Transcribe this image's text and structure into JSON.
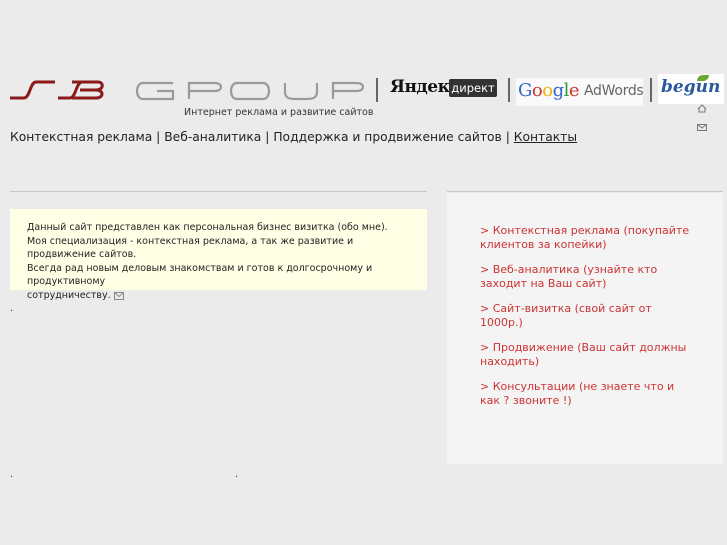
{
  "brand": {
    "logo_s3_name": "S3",
    "logo_group_name": "GROUP",
    "tagline": "Интернет реклама и развитие сайтов"
  },
  "partners": {
    "yandex_name": "Яндекс",
    "yandex_product": "директ",
    "google_name": "Google",
    "google_product": "AdWords",
    "begun_name": "begun"
  },
  "nav": {
    "items": [
      "Контекстная реклама",
      "Веб-аналитика",
      "Поддержка и продвижение сайтов",
      "Контакты"
    ],
    "separator": " | "
  },
  "intro": {
    "lines": [
      "Данный сайт представлен как персональная бизнес визитка (обо мне).",
      "Моя специализация - контекстная реклама, а так же развитие и продвижение сайтов.",
      "Всегда рад новым деловым знакомствам и готов к долгосрочному и продуктивному",
      "сотрудничеству."
    ]
  },
  "dots": [
    ".",
    ".",
    "."
  ],
  "sidebar": {
    "items": [
      "> Контекстная реклама (покупайте клиентов за копейки)",
      "> Веб-аналитика (узнайте кто заходит на Ваш сайт)",
      "> Сайт-визитка (свой сайт от 1000р.)",
      "> Продвижение (Ваш сайт должны находить)",
      "> Консультации (не знаете что и как ? звоните !)"
    ]
  },
  "colors": {
    "logo_red": "#8b1a1a",
    "logo_gray": "#9a9a9a",
    "sidebar_link": "#cc3333",
    "intro_bg": "#ffffe6"
  },
  "icons": [
    "home-icon",
    "mail-icon"
  ]
}
